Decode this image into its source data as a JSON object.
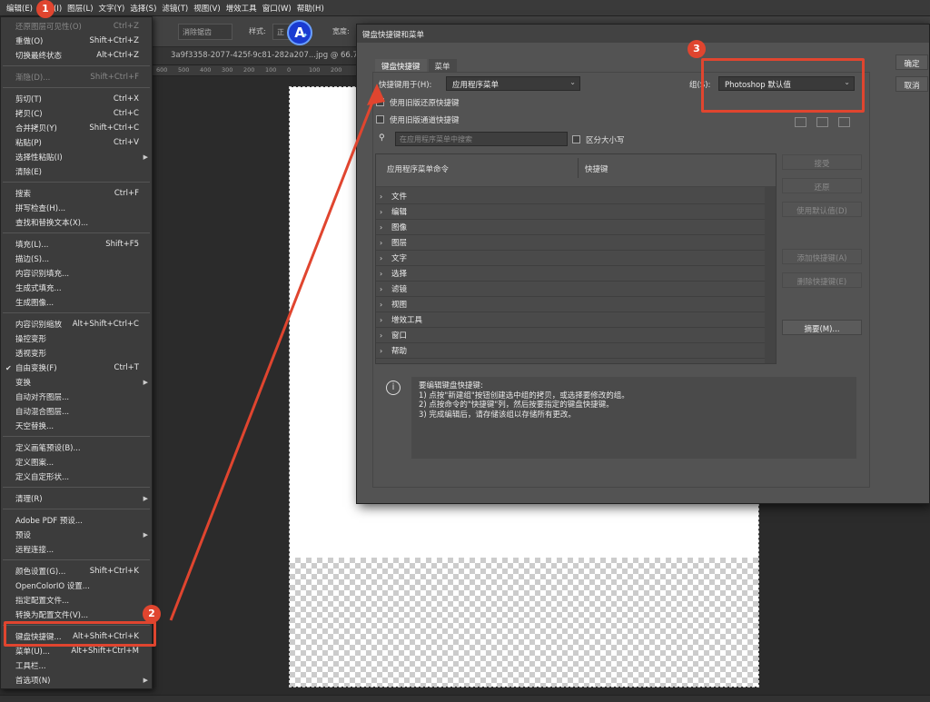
{
  "colors": {
    "annotation": "#e0452f",
    "menubar": "#3a3a3a",
    "dialog": "#535353"
  },
  "menubar": {
    "items": [
      "编辑(E)",
      "图像(I)",
      "图层(L)",
      "文字(Y)",
      "选择(S)",
      "滤镜(T)",
      "视图(V)",
      "增效工具",
      "窗口(W)",
      "帮助(H)"
    ]
  },
  "optbar": {
    "antialias": "消除锯齿",
    "style_label": "样式:",
    "style_value": "正",
    "width_label": "宽度:"
  },
  "document": {
    "tab_title": "3a9f3358-2077-425f-9c81-282a207...jpg @ 66.7%",
    "ruler_ticks": [
      "600",
      "500",
      "400",
      "300",
      "200",
      "100",
      "0",
      "100",
      "200"
    ]
  },
  "logo": {
    "letter": "A"
  },
  "edit_menu": {
    "items": [
      {
        "label": "还原图层可见性(O)",
        "shortcut": "Ctrl+Z"
      },
      {
        "label": "重做(O)",
        "shortcut": "Shift+Ctrl+Z"
      },
      {
        "label": "切换最终状态",
        "shortcut": "Alt+Ctrl+Z"
      },
      {
        "label": "渐隐(D)...",
        "shortcut": "Shift+Ctrl+F"
      },
      {
        "label": "剪切(T)",
        "shortcut": "Ctrl+X"
      },
      {
        "label": "拷贝(C)",
        "shortcut": "Ctrl+C"
      },
      {
        "label": "合并拷贝(Y)",
        "shortcut": "Shift+Ctrl+C"
      },
      {
        "label": "粘贴(P)",
        "shortcut": "Ctrl+V"
      },
      {
        "label": "选择性粘贴(I)",
        "shortcut": ""
      },
      {
        "label": "清除(E)",
        "shortcut": ""
      },
      {
        "label": "搜索",
        "shortcut": "Ctrl+F"
      },
      {
        "label": "拼写检查(H)...",
        "shortcut": ""
      },
      {
        "label": "查找和替换文本(X)...",
        "shortcut": ""
      },
      {
        "label": "填充(L)...",
        "shortcut": "Shift+F5"
      },
      {
        "label": "描边(S)...",
        "shortcut": ""
      },
      {
        "label": "内容识别填充...",
        "shortcut": ""
      },
      {
        "label": "生成式填充...",
        "shortcut": ""
      },
      {
        "label": "生成图像...",
        "shortcut": ""
      },
      {
        "label": "内容识别缩放",
        "shortcut": "Alt+Shift+Ctrl+C"
      },
      {
        "label": "操控变形",
        "shortcut": ""
      },
      {
        "label": "透视变形",
        "shortcut": ""
      },
      {
        "label": "自由变换(F)",
        "shortcut": "Ctrl+T"
      },
      {
        "label": "变换",
        "shortcut": ""
      },
      {
        "label": "自动对齐图层...",
        "shortcut": ""
      },
      {
        "label": "自动混合图层...",
        "shortcut": ""
      },
      {
        "label": "天空替换...",
        "shortcut": ""
      },
      {
        "label": "定义画笔预设(B)...",
        "shortcut": ""
      },
      {
        "label": "定义图案...",
        "shortcut": ""
      },
      {
        "label": "定义自定形状...",
        "shortcut": ""
      },
      {
        "label": "清理(R)",
        "shortcut": ""
      },
      {
        "label": "Adobe PDF 预设...",
        "shortcut": ""
      },
      {
        "label": "预设",
        "shortcut": ""
      },
      {
        "label": "远程连接...",
        "shortcut": ""
      },
      {
        "label": "颜色设置(G)...",
        "shortcut": "Shift+Ctrl+K"
      },
      {
        "label": "OpenColorIO 设置...",
        "shortcut": ""
      },
      {
        "label": "指定配置文件...",
        "shortcut": ""
      },
      {
        "label": "转换为配置文件(V)...",
        "shortcut": ""
      },
      {
        "label": "键盘快捷键...",
        "shortcut": "Alt+Shift+Ctrl+K"
      },
      {
        "label": "菜单(U)...",
        "shortcut": "Alt+Shift+Ctrl+M"
      },
      {
        "label": "工具栏...",
        "shortcut": ""
      },
      {
        "label": "首选项(N)",
        "shortcut": ""
      }
    ]
  },
  "dialog": {
    "title": "键盘快捷键和菜单",
    "tabs": [
      "键盘快捷键",
      "菜单"
    ],
    "shortcuts_for_label": "快捷键用于(H):",
    "shortcuts_for_value": "应用程序菜单",
    "set_label": "组(S):",
    "set_value": "Photoshop 默认值",
    "use_legacy_undo": "使用旧版还原快捷键",
    "use_legacy_channel": "使用旧版通道快捷键",
    "search_placeholder": "在应用程序菜单中搜索",
    "case_sensitive": "区分大小写",
    "col_command": "应用程序菜单命令",
    "col_shortcut": "快捷键",
    "tree_items": [
      "文件",
      "编辑",
      "图像",
      "图层",
      "文字",
      "选择",
      "滤镜",
      "视图",
      "增效工具",
      "窗口",
      "帮助"
    ],
    "buttons": {
      "ok": "确定",
      "cancel": "取消",
      "accept": "接受",
      "undo": "还原",
      "use_default": "使用默认值(D)",
      "add_shortcut": "添加快捷键(A)",
      "delete_shortcut": "删除快捷键(E)",
      "summarize": "摘要(M)..."
    },
    "info_lines": [
      "要编辑键盘快捷键:",
      "1) 点按\"新建组\"按钮创建选中组的拷贝，或选择要修改的组。",
      "2) 点按命令的\"快捷键\"列，然后按要指定的键盘快捷键。",
      "3) 完成编辑后，请存储该组以存储所有更改。"
    ]
  },
  "annotations": {
    "m1": "1",
    "m2": "2",
    "m3": "3"
  }
}
